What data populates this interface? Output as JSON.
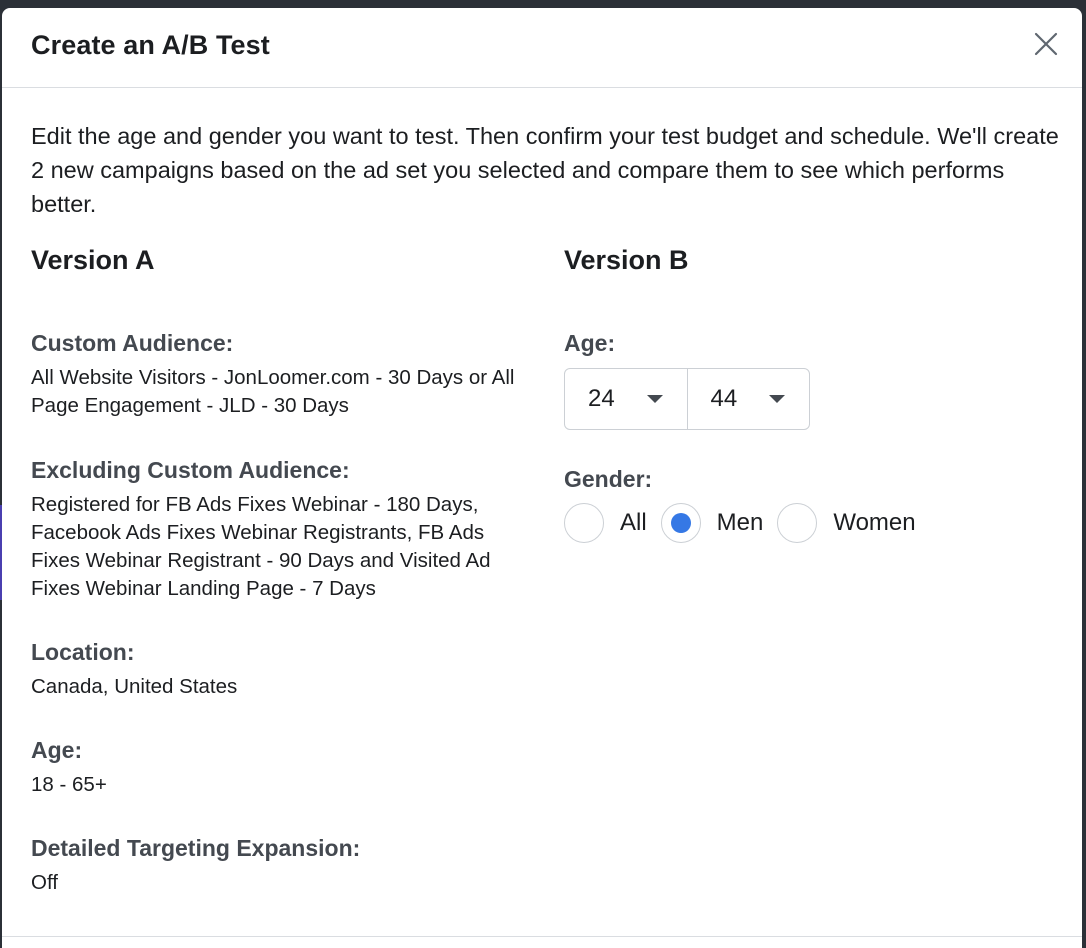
{
  "dialog": {
    "title": "Create an A/B Test",
    "intro": "Edit the age and gender you want to test. Then confirm your test budget and schedule. We'll create 2 new campaigns based on the ad set you selected and compare them to see which performs better."
  },
  "version_a": {
    "title": "Version A",
    "custom_audience_label": "Custom Audience:",
    "custom_audience_value": "All Website Visitors - JonLoomer.com - 30 Days or All Page Engagement - JLD - 30 Days",
    "excluding_label": "Excluding Custom Audience:",
    "excluding_value": "Registered for FB Ads Fixes Webinar - 180 Days, Facebook Ads Fixes Webinar Registrants, FB Ads Fixes Webinar Registrant - 90 Days and Visited Ad Fixes Webinar Landing Page - 7 Days",
    "location_label": "Location:",
    "location_value": "Canada, United States",
    "age_label": "Age:",
    "age_value": "18 - 65+",
    "expansion_label": "Detailed Targeting Expansion:",
    "expansion_value": "Off"
  },
  "version_b": {
    "title": "Version B",
    "age_label": "Age:",
    "age_min": "24",
    "age_max": "44",
    "gender_label": "Gender:",
    "gender_options": [
      "All",
      "Men",
      "Women"
    ],
    "gender_selected": "Men"
  },
  "colors": {
    "accent": "#3578e5",
    "border": "#ccd0d5",
    "text": "#1c1e21",
    "label": "#444950"
  },
  "icons": {
    "close": "close-icon",
    "dropdown": "chevron-down-icon"
  }
}
